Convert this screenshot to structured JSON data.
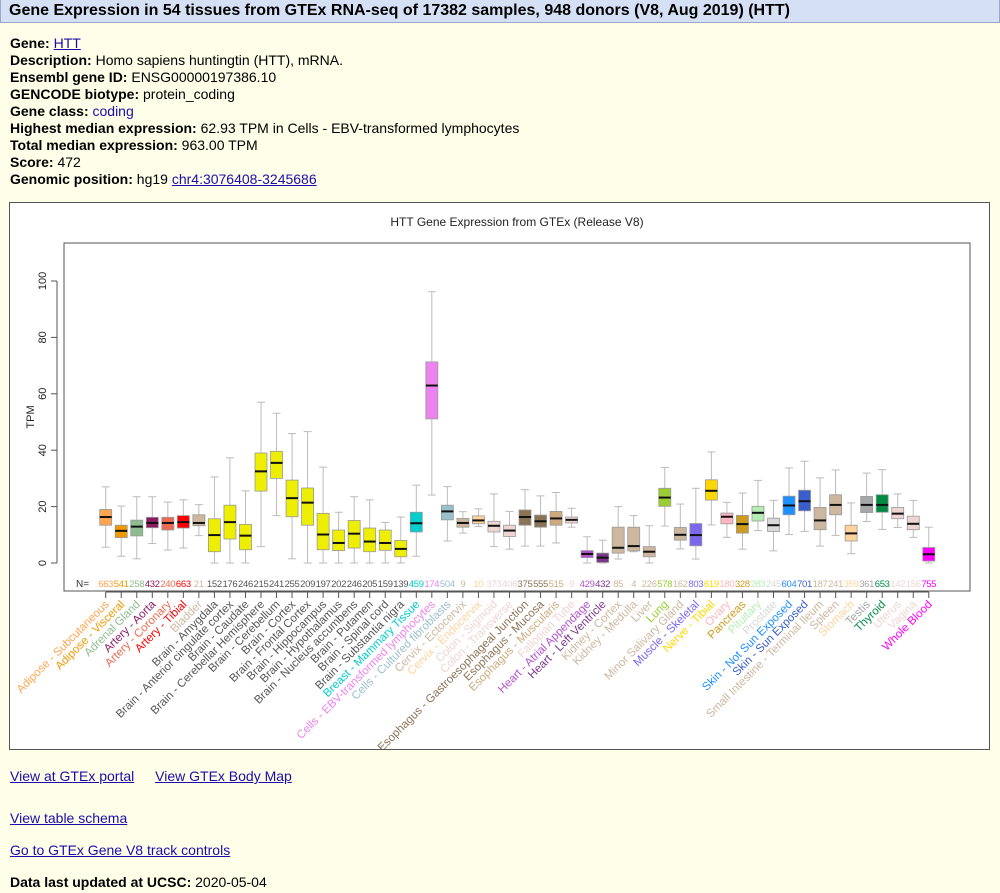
{
  "header": {
    "title": "Gene Expression in 54 tissues from GTEx RNA-seq of 17382 samples, 948 donors (V8, Aug 2019) (HTT)"
  },
  "info": [
    {
      "label": "Gene:",
      "value": "HTT",
      "link": true
    },
    {
      "label": "Description:",
      "value": "Homo sapiens huntingtin (HTT), mRNA."
    },
    {
      "label": "Ensembl gene ID:",
      "value": "ENSG00000197386.10"
    },
    {
      "label": "GENCODE biotype:",
      "value": "protein_coding"
    },
    {
      "label": "Gene class:",
      "value": "coding",
      "link_colored": true
    },
    {
      "label": "Highest median expression:",
      "value": "62.93 TPM in Cells - EBV-transformed lymphocytes"
    },
    {
      "label": "Total median expression:",
      "value": "963.00 TPM"
    },
    {
      "label": "Score:",
      "value": "472"
    },
    {
      "label": "Genomic position:",
      "value": "hg19",
      "link_value": "chr4:3076408-3245686"
    }
  ],
  "links": {
    "gtex_portal": "View at GTEx portal",
    "body_map": "View GTEx Body Map",
    "table_schema": "View table schema",
    "track_controls": "Go to GTEx Gene V8 track controls",
    "updated_label": "Data last updated at UCSC:",
    "updated_value": "2020-05-04"
  },
  "chart_data": {
    "type": "box",
    "title": "HTT Gene Expression from GTEx (Release V8)",
    "ylabel": "TPM",
    "ylim": [
      0,
      110
    ],
    "yticks": [
      0,
      20,
      40,
      60,
      80,
      100
    ],
    "n_label": "N=",
    "grid": false,
    "box_fields": [
      "median",
      "q1",
      "q3",
      "whisker_low",
      "whisker_high"
    ],
    "tissues": [
      {
        "name": "Adipose - Subcutaneous",
        "n": "663",
        "color": "#FFA54F",
        "box": [
          16.3,
          13.4,
          19.0,
          5.6,
          27.0
        ]
      },
      {
        "name": "Adipose - Visceral",
        "n": "541",
        "color": "#EE9A00",
        "box": [
          11.4,
          9.0,
          13.4,
          2.4,
          20.2
        ]
      },
      {
        "name": "Adrenal Gland",
        "n": "258",
        "color": "#8FBC8F",
        "box": [
          12.9,
          9.6,
          15.2,
          1.5,
          23.5
        ]
      },
      {
        "name": "Artery - Aorta",
        "n": "432",
        "color": "#8B1C62",
        "box": [
          14.2,
          12.5,
          16.2,
          6.9,
          23.5
        ]
      },
      {
        "name": "Artery - Coronary",
        "n": "240",
        "color": "#EE6A50",
        "box": [
          14.2,
          11.7,
          16.2,
          4.6,
          21.6
        ]
      },
      {
        "name": "Artery - Tibial",
        "n": "663",
        "color": "#FF0000",
        "box": [
          14.5,
          12.4,
          16.8,
          5.3,
          22.4
        ]
      },
      {
        "name": "Bladder",
        "n": "21",
        "color": "#CDB79E",
        "box": [
          14.2,
          13.2,
          17.1,
          9.7,
          20.7
        ]
      },
      {
        "name": "Brain - Amygdala",
        "n": "152",
        "color": "#EEEE00",
        "box": [
          9.9,
          4.0,
          15.7,
          0,
          30.5
        ]
      },
      {
        "name": "Brain - Anterior cingulate cortex",
        "n": "176",
        "color": "#EEEE00",
        "box": [
          14.5,
          8.5,
          20.5,
          0,
          37.3
        ]
      },
      {
        "name": "Brain - Caudate",
        "n": "246",
        "color": "#EEEE00",
        "box": [
          9.7,
          4.7,
          13.7,
          0,
          25.6
        ]
      },
      {
        "name": "Brain - Cerebellar Hemisphere",
        "n": "215",
        "color": "#EEEE00",
        "box": [
          32.5,
          25.5,
          39.0,
          5.8,
          57.0
        ]
      },
      {
        "name": "Brain - Cerebellum",
        "n": "241",
        "color": "#EEEE00",
        "box": [
          35.5,
          30.0,
          39.6,
          16.8,
          53.1
        ]
      },
      {
        "name": "Brain - Cortex",
        "n": "255",
        "color": "#EEEE00",
        "box": [
          23.0,
          16.4,
          29.4,
          1.5,
          45.9
        ]
      },
      {
        "name": "Brain - Frontal Cortex",
        "n": "209",
        "color": "#EEEE00",
        "box": [
          21.4,
          13.4,
          26.6,
          0,
          46.6
        ]
      },
      {
        "name": "Brain - Hippocampus",
        "n": "197",
        "color": "#EEEE00",
        "box": [
          10.1,
          4.7,
          17.6,
          0,
          34.0
        ]
      },
      {
        "name": "Brain - Hypothalamus",
        "n": "202",
        "color": "#EEEE00",
        "box": [
          7.1,
          4.4,
          11.7,
          0,
          18.0
        ]
      },
      {
        "name": "Brain - Nucleus accumbens",
        "n": "246",
        "color": "#EEEE00",
        "box": [
          10.4,
          5.3,
          15.1,
          0,
          23.5
        ]
      },
      {
        "name": "Brain - Putamen",
        "n": "205",
        "color": "#EEEE00",
        "box": [
          7.6,
          4.0,
          12.4,
          0,
          22.4
        ]
      },
      {
        "name": "Brain - Spinal cord",
        "n": "159",
        "color": "#EEEE00",
        "box": [
          7.1,
          4.5,
          11.7,
          0,
          14.4
        ]
      },
      {
        "name": "Brain - Substantia nigra",
        "n": "139",
        "color": "#EEEE00",
        "box": [
          5.0,
          2.2,
          8.0,
          0,
          16.3
        ]
      },
      {
        "name": "Breast - Mammary Tissue",
        "n": "459",
        "color": "#00CDCD",
        "box": [
          14.1,
          11.0,
          18.0,
          2.4,
          27.6
        ]
      },
      {
        "name": "Cells - EBV-transformed lymphocytes",
        "n": "174",
        "color": "#EE82EE",
        "box": [
          62.93,
          51.1,
          71.3,
          24.1,
          96.2
        ]
      },
      {
        "name": "Cells - Cultured fibroblasts",
        "n": "504",
        "color": "#9AC0CD",
        "box": [
          18.3,
          15.3,
          20.5,
          7.8,
          27.1
        ]
      },
      {
        "name": "Cervix - Ectocervix",
        "n": "9",
        "color": "#CDB79E",
        "box": [
          14.2,
          12.7,
          15.8,
          10.6,
          18.2
        ]
      },
      {
        "name": "Cervix - Endocervix",
        "n": "10",
        "color": "#FFD39B",
        "box": [
          15.1,
          13.9,
          16.7,
          12.9,
          19.2
        ]
      },
      {
        "name": "Colon - Sigmoid",
        "n": "373",
        "color": "#EED5D2",
        "box": [
          13.2,
          11.0,
          14.8,
          5.8,
          24.5
        ]
      },
      {
        "name": "Colon - Transverse",
        "n": "406",
        "color": "#EED5D2",
        "box": [
          11.5,
          9.4,
          13.4,
          4.9,
          18.3
        ]
      },
      {
        "name": "Esophagus - Gastroesophageal Junction",
        "n": "375",
        "color": "#8B7355",
        "box": [
          16.3,
          13.4,
          18.8,
          6.0,
          26.0
        ]
      },
      {
        "name": "Esophagus - Mucosa",
        "n": "555",
        "color": "#8B7355",
        "box": [
          14.8,
          12.7,
          17.0,
          6.0,
          23.8
        ]
      },
      {
        "name": "Esophagus - Muscularis",
        "n": "515",
        "color": "#CDAA7D",
        "box": [
          15.8,
          13.4,
          18.3,
          7.1,
          25.0
        ]
      },
      {
        "name": "Fallopian Tube",
        "n": "9",
        "color": "#EED5D2",
        "box": [
          15.3,
          14.2,
          16.3,
          12.7,
          19.4
        ]
      },
      {
        "name": "Heart - Atrial Appendage",
        "n": "429",
        "color": "#B452CD",
        "box": [
          3.2,
          1.9,
          4.4,
          0,
          9.3
        ]
      },
      {
        "name": "Heart - Left Ventricle",
        "n": "432",
        "color": "#7A378B",
        "box": [
          1.9,
          0.2,
          3.5,
          0,
          8.1
        ]
      },
      {
        "name": "Kidney - Cortex",
        "n": "85",
        "color": "#CDB79E",
        "box": [
          5.4,
          3.5,
          12.7,
          1.4,
          20.0
        ]
      },
      {
        "name": "Kidney - Medulla",
        "n": "4",
        "color": "#CDB79E",
        "box": [
          6.0,
          4.3,
          12.7,
          4.0,
          16.8
        ]
      },
      {
        "name": "Liver",
        "n": "226",
        "color": "#CDB79E",
        "box": [
          4.0,
          2.2,
          5.8,
          0,
          13.2
        ]
      },
      {
        "name": "Lung",
        "n": "578",
        "color": "#9ACD32",
        "box": [
          23.2,
          20.1,
          26.5,
          13.1,
          33.9
        ]
      },
      {
        "name": "Minor Salivary Gland",
        "n": "162",
        "color": "#CDB79E",
        "box": [
          10.0,
          8.1,
          12.6,
          5.0,
          20.9
        ]
      },
      {
        "name": "Muscle - Skeletal",
        "n": "803",
        "color": "#7A67EE",
        "box": [
          9.9,
          6.1,
          14.0,
          1.4,
          26.5
        ]
      },
      {
        "name": "Nerve - Tibial",
        "n": "619",
        "color": "#FFD700",
        "box": [
          25.6,
          22.3,
          29.5,
          13.5,
          39.4
        ]
      },
      {
        "name": "Ovary",
        "n": "180",
        "color": "#FFB6C1",
        "box": [
          16.4,
          13.9,
          17.7,
          9.1,
          21.5
        ]
      },
      {
        "name": "Pancreas",
        "n": "328",
        "color": "#CD9B1D",
        "box": [
          13.8,
          10.6,
          16.9,
          4.9,
          24.8
        ]
      },
      {
        "name": "Pituitary",
        "n": "283",
        "color": "#B4EEB4",
        "box": [
          17.8,
          14.9,
          20.1,
          11.5,
          29.3
        ]
      },
      {
        "name": "Prostate",
        "n": "245",
        "color": "#D9D9D9",
        "box": [
          13.4,
          11.2,
          15.9,
          4.3,
          22.2
        ]
      },
      {
        "name": "Skin - Not Sun Exposed",
        "n": "604",
        "color": "#1E90FF",
        "box": [
          20.4,
          17.1,
          23.7,
          10.1,
          33.7
        ]
      },
      {
        "name": "Skin - Sun Exposed",
        "n": "701",
        "color": "#3A5FCD",
        "box": [
          21.9,
          18.5,
          25.8,
          11.2,
          36.1
        ]
      },
      {
        "name": "Small Intestine - Terminal Ileum",
        "n": "187",
        "color": "#CDB79E",
        "box": [
          15.1,
          11.8,
          19.7,
          6.0,
          30.2
        ]
      },
      {
        "name": "Spleen",
        "n": "241",
        "color": "#CDB79E",
        "box": [
          20.6,
          17.1,
          24.2,
          9.8,
          33.0
        ]
      },
      {
        "name": "Stomach",
        "n": "359",
        "color": "#FFD39B",
        "box": [
          10.5,
          7.8,
          13.4,
          3.3,
          21.3
        ]
      },
      {
        "name": "Testis",
        "n": "361",
        "color": "#A6A6A6",
        "box": [
          20.6,
          17.9,
          23.6,
          14.7,
          31.9
        ]
      },
      {
        "name": "Thyroid",
        "n": "653",
        "color": "#008B45",
        "box": [
          20.6,
          18.0,
          24.2,
          11.9,
          33.1
        ]
      },
      {
        "name": "Uterus",
        "n": "142",
        "color": "#EED5D2",
        "box": [
          17.5,
          15.7,
          19.7,
          12.6,
          24.5
        ]
      },
      {
        "name": "Vagina",
        "n": "156",
        "color": "#EED5D2",
        "box": [
          13.9,
          11.8,
          16.6,
          9.1,
          22.2
        ]
      },
      {
        "name": "Whole Blood",
        "n": "755",
        "color": "#FF00FF",
        "box": [
          3.1,
          0.7,
          5.5,
          0,
          12.7
        ]
      }
    ]
  }
}
